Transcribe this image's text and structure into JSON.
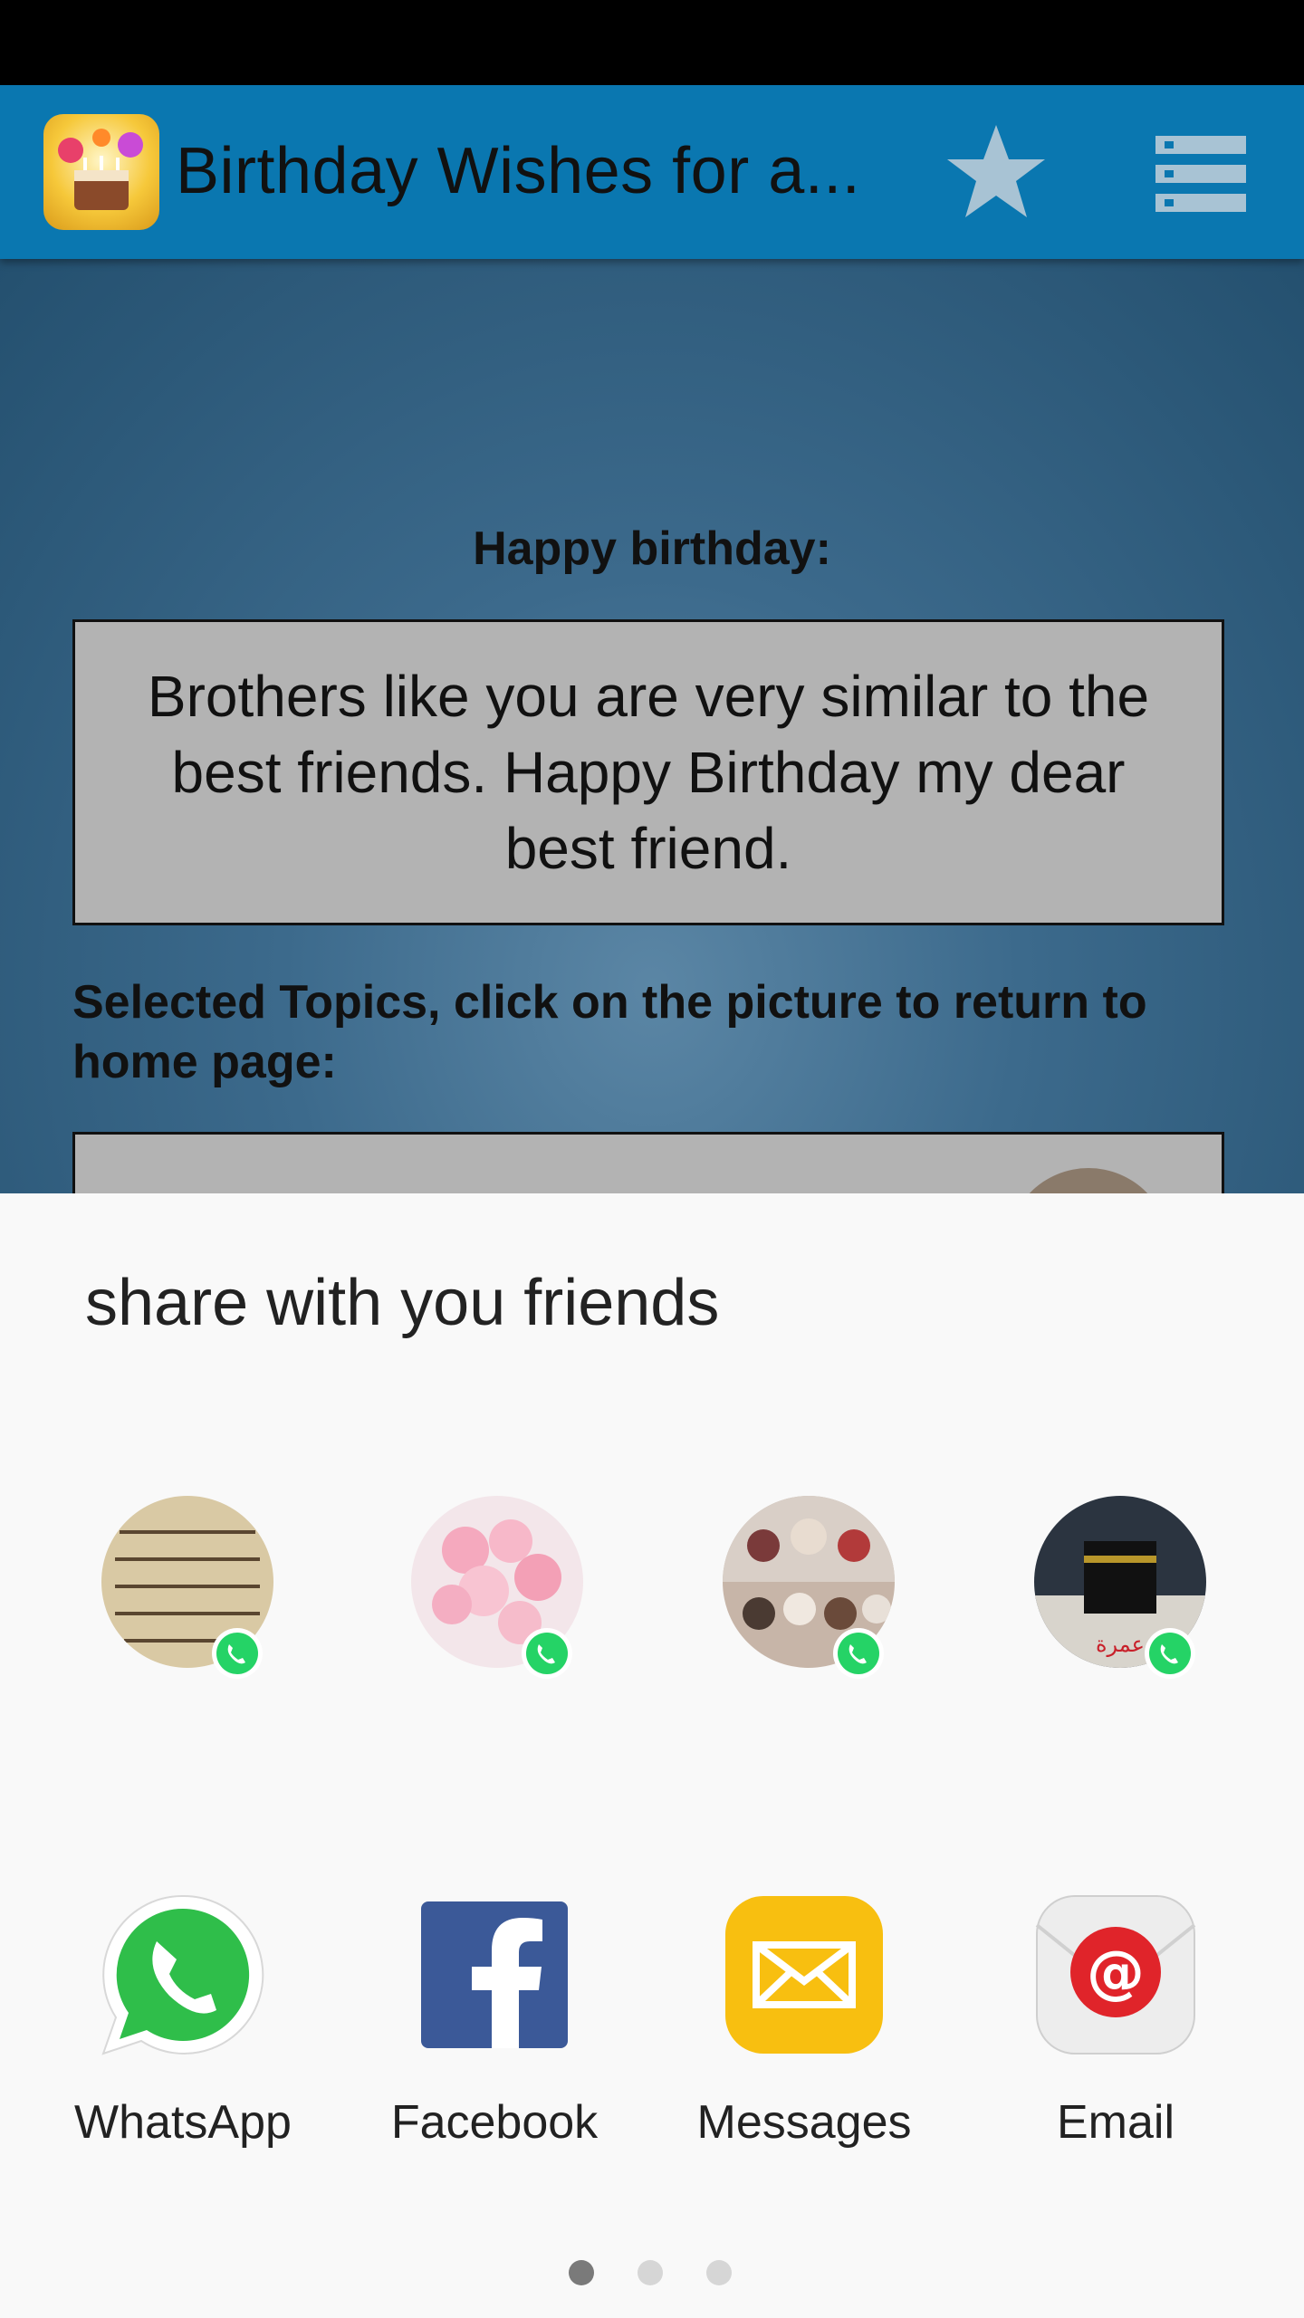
{
  "app_bar": {
    "title": "Birthday Wishes for a...",
    "icon": "birthday-cake-icon",
    "favorite_icon": "star-icon",
    "menu_icon": "list-menu-icon",
    "color": "#0a77b0"
  },
  "content": {
    "heading": "Happy birthday:",
    "wish_text": "Brothers like you are very similar to the best friends. Happy Birthday my dear best friend.",
    "topics_label": "Selected Topics, click on the picture to return to home page:"
  },
  "share_sheet": {
    "title": "share with you friends",
    "contacts": [
      {
        "badge": "whatsapp-icon"
      },
      {
        "badge": "whatsapp-icon"
      },
      {
        "badge": "whatsapp-icon"
      },
      {
        "badge": "whatsapp-icon"
      }
    ],
    "apps": [
      {
        "label": "WhatsApp",
        "icon": "whatsapp-icon",
        "color": "#25d366"
      },
      {
        "label": "Facebook",
        "icon": "facebook-icon",
        "color": "#3b5998"
      },
      {
        "label": "Messages",
        "icon": "messages-icon",
        "color": "#f5b400"
      },
      {
        "label": "Email",
        "icon": "email-icon",
        "color": "#e0242a"
      }
    ],
    "page_count": 3,
    "current_page": 1
  }
}
